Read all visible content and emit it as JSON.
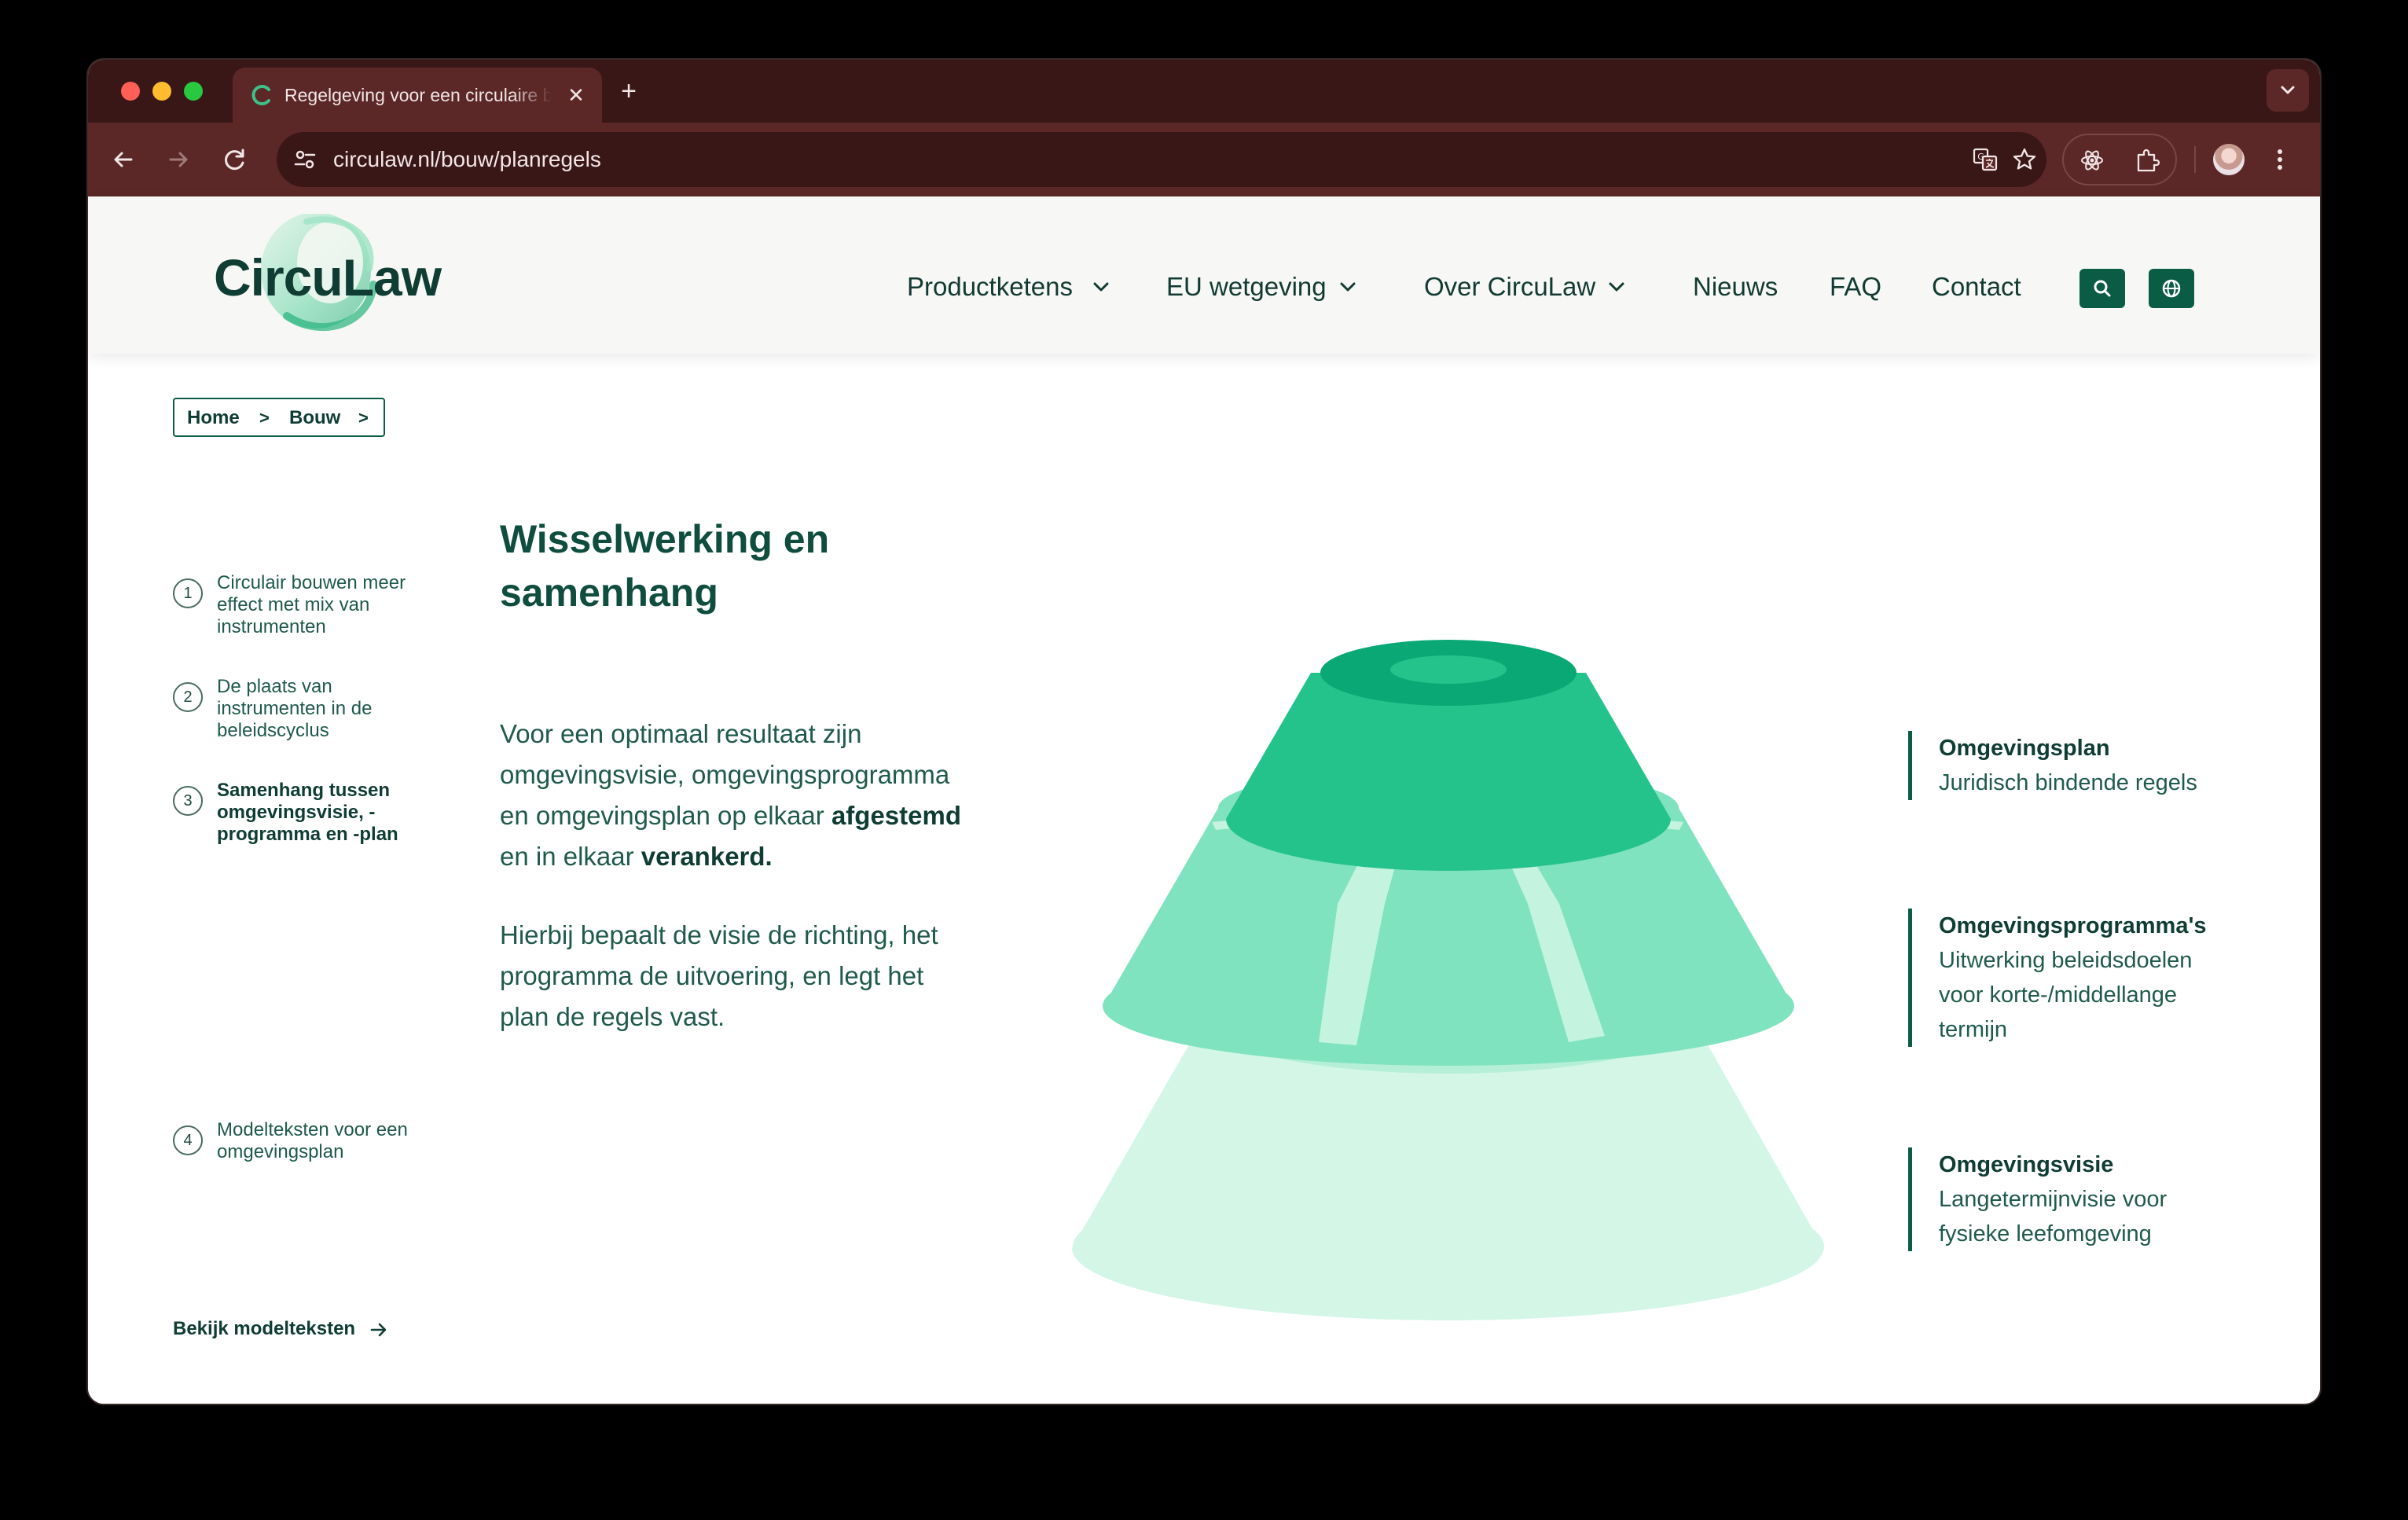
{
  "browser": {
    "tab_title": "Regelgeving voor een circulaire bouw",
    "url": "circulaw.nl/bouw/planregels"
  },
  "site": {
    "logo_text": "CircuLaw",
    "nav": [
      {
        "label": "Productketens",
        "has_dropdown": true
      },
      {
        "label": "EU wetgeving",
        "has_dropdown": true
      },
      {
        "label": "Over CircuLaw",
        "has_dropdown": true
      },
      {
        "label": "Nieuws",
        "has_dropdown": false
      },
      {
        "label": "FAQ",
        "has_dropdown": false
      },
      {
        "label": "Contact",
        "has_dropdown": false
      }
    ],
    "accent_color": "#0b5c45"
  },
  "breadcrumb": {
    "items": [
      "Home",
      "Bouw"
    ],
    "separator": ">"
  },
  "steps": [
    {
      "number": "1",
      "label": "Circulair bouwen meer effect met mix van instrumenten",
      "active": false
    },
    {
      "number": "2",
      "label": "De plaats van instrumenten in de beleidscyclus",
      "active": false
    },
    {
      "number": "3",
      "label": "Samenhang tussen omgevingsvisie, -programma en -plan",
      "active": true
    },
    {
      "number": "4",
      "label": "Modelteksten voor een omgevingsplan",
      "active": false
    }
  ],
  "models_link": "Bekijk modelteksten",
  "content": {
    "title": "Wisselwerking en samenhang",
    "p1_before": "Voor een optimaal resultaat zijn omgevingsvisie, omgevingsprogramma en omgevingsplan op elkaar ",
    "p1_bold1": "afgestemd",
    "p1_middle": " en in elkaar ",
    "p1_bold2": "verankerd.",
    "p2": "Hierbij bepaalt de visie de richting, het programma de uitvoering, en legt het plan de regels vast."
  },
  "legend": [
    {
      "title": "Omgevingsplan",
      "desc": "Juridisch bindende regels"
    },
    {
      "title": "Omgevingsprogramma's",
      "desc": "Uitwerking beleidsdoelen voor korte-/middellange termijn"
    },
    {
      "title": "Omgevingsvisie",
      "desc": "Langetermijnvisie voor fysieke leefomgeving"
    }
  ]
}
